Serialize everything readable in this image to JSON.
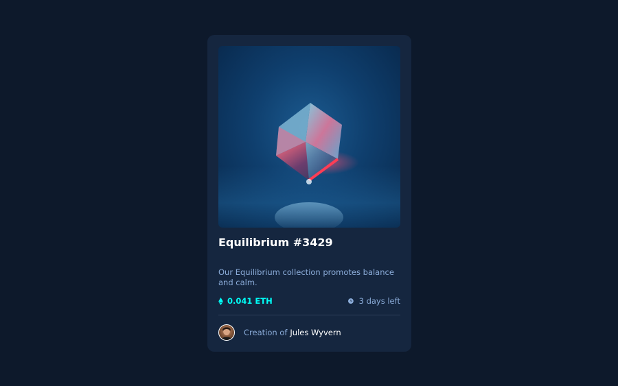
{
  "card": {
    "title": "Equilibrium #3429",
    "description": "Our Equilibrium collection promotes balance and calm.",
    "price": "0.041 ETH",
    "time_left": "3 days left",
    "creator_prefix": "Creation of",
    "creator_name": "Jules Wyvern"
  },
  "icons": {
    "price": "ethereum-icon",
    "time": "clock-icon"
  },
  "colors": {
    "page_bg": "#0d192b",
    "card_bg": "#15263f",
    "accent_cyan": "#00fff8",
    "soft_blue": "#8bacd9",
    "divider": "#2e405a",
    "white": "#ffffff"
  }
}
